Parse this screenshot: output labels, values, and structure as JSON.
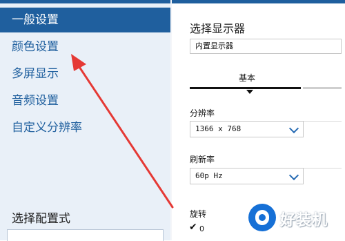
{
  "sidebar": {
    "items": [
      {
        "label": "一般设置",
        "active": true
      },
      {
        "label": "颜色设置",
        "active": false
      },
      {
        "label": "多屏显示",
        "active": false
      },
      {
        "label": "音频设置",
        "active": false
      },
      {
        "label": "自定义分辨率",
        "active": false
      }
    ],
    "footer_label": "选择配置式"
  },
  "main": {
    "select_display_title": "选择显示器",
    "display_value": "内置显示器",
    "display_tab_label": "基本",
    "resolution": {
      "label": "分辨率",
      "value": "1366 x 768"
    },
    "refresh_rate": {
      "label": "刷新率",
      "value": "60p Hz"
    },
    "rotation": {
      "label": "旋转",
      "value": "0"
    }
  },
  "watermark": {
    "text": "好装机"
  },
  "colors": {
    "accent": "#1f5f9e",
    "sidebar_bg": "#e9f0f8",
    "arrow": "#e53935",
    "watermark": "#1670d6"
  }
}
